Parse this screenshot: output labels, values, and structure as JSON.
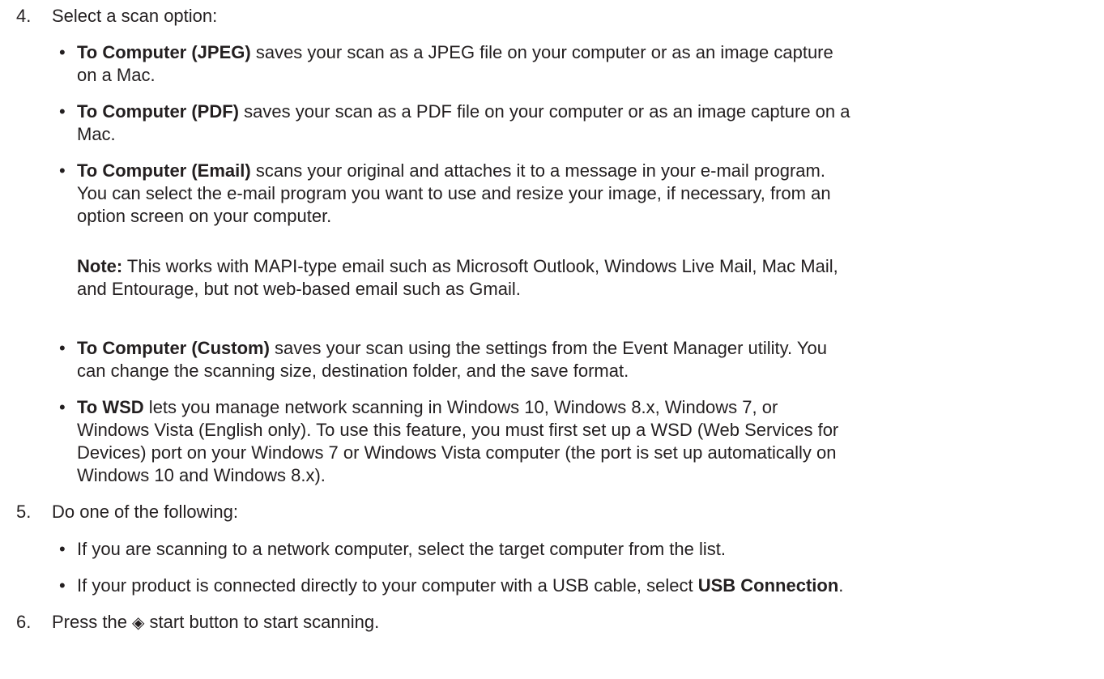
{
  "steps": {
    "s4": {
      "number": "4.",
      "text": "Select a scan option:",
      "items": [
        {
          "term": "To Computer (JPEG)",
          "line1": " saves your scan as a JPEG file on your computer or as an image capture",
          "line2": "on a Mac."
        },
        {
          "term": "To Computer (PDF)",
          "line1": " saves your scan as a PDF file on your computer or as an image capture on a",
          "line2": "Mac."
        },
        {
          "term": "To Computer (Email)",
          "line1": " scans your original and attaches it to a message in your e-mail program.",
          "line2": "You can select the e-mail program you want to use and resize your image, if necessary, from an",
          "line3": "option screen on your computer."
        },
        {
          "term": "To Computer (Custom)",
          "line1": " saves your scan using the settings from the Event Manager utility. You",
          "line2": "can change the scanning size, destination folder, and the save format."
        },
        {
          "term": "To WSD",
          "line1": " lets you manage network scanning in Windows 10, Windows 8.x, Windows 7, or",
          "line2": "Windows Vista (English only). To use this feature, you must first set up a WSD (Web Services for",
          "line3": "Devices) port on your Windows 7 or Windows Vista computer (the port is set up automatically on",
          "line4": "Windows 10 and Windows 8.x)."
        }
      ],
      "note": {
        "label": "Note:",
        "line1": " This works with MAPI-type email such as Microsoft Outlook, Windows Live Mail, Mac Mail,",
        "line2": "and Entourage, but not web-based email such as Gmail."
      }
    },
    "s5": {
      "number": "5.",
      "text": "Do one of the following:",
      "items": [
        {
          "line1": "If you are scanning to a network computer, select the target computer from the list."
        },
        {
          "line1": "If your product is connected directly to your computer with a USB cable, select ",
          "term": "USB Connection",
          "tail": "."
        }
      ]
    },
    "s6": {
      "number": "6.",
      "text_before": "Press the ",
      "icon": "start-icon",
      "icon_glyph": "◈",
      "text_after": " start button to start scanning."
    }
  },
  "bullet": "•"
}
